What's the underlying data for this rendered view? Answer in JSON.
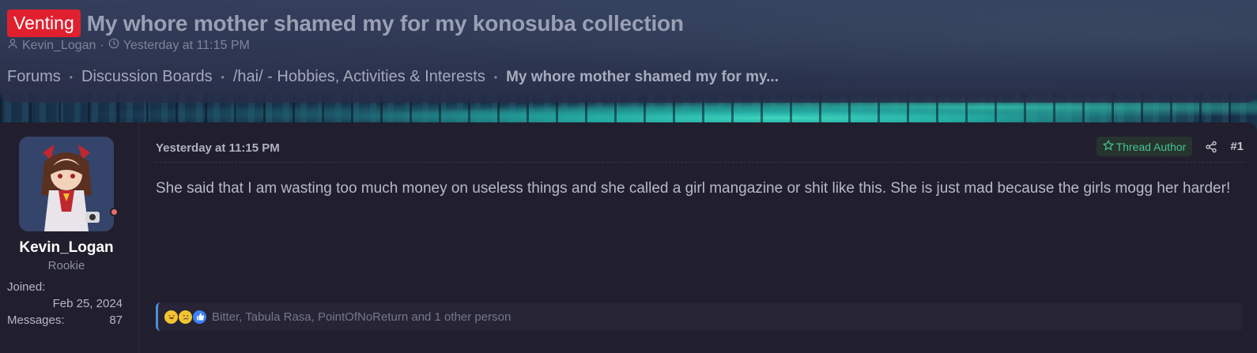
{
  "thread": {
    "prefix": "Venting",
    "title": "My whore mother shamed my for my konosuba collection",
    "author": "Kevin_Logan",
    "meta_sep": "·",
    "posted": "Yesterday at 11:15 PM"
  },
  "breadcrumb": {
    "items": [
      "Forums",
      "Discussion Boards",
      "/hai/ - Hobbies, Activities & Interests",
      "My whore mother shamed my for my..."
    ],
    "separator": "•"
  },
  "post": {
    "user": {
      "name": "Kevin_Logan",
      "title": "Rookie",
      "joined_label": "Joined:",
      "joined_value": "Feb 25, 2024",
      "messages_label": "Messages:",
      "messages_value": "87",
      "status_color": "#ea6c6c"
    },
    "date": "Yesterday at 11:15 PM",
    "author_badge": "Thread Author",
    "number": "#1",
    "body": "She said that I am wasting too much money on useless things and she called a girl mangazine or shit like this. She is just mad because the girls mogg her harder!",
    "reactions": {
      "icons": [
        "rofl-icon",
        "sad-icon",
        "like-icon"
      ],
      "text": "Bitter, Tabula Rasa, PointOfNoReturn and 1 other person"
    }
  },
  "colors": {
    "prefix_bg": "#e0202f",
    "author_badge": "#45c58b",
    "reactions_accent": "#4a8fd9"
  }
}
